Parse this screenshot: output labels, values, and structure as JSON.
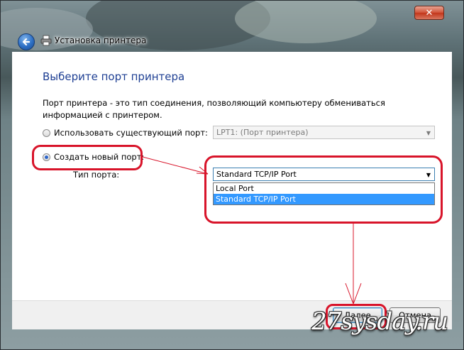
{
  "window": {
    "title": "Установка принтера",
    "close_glyph": "✕"
  },
  "page": {
    "heading": "Выберите порт принтера",
    "description": "Порт принтера - это тип соединения, позволяющий компьютеру обмениваться информацией с принтером."
  },
  "options": {
    "existing_port": {
      "label": "Использовать существующий порт:",
      "selected": false,
      "value": "LPT1: (Порт принтера)"
    },
    "new_port": {
      "label": "Создать новый порт:",
      "selected": true
    },
    "port_type": {
      "label": "Тип порта:",
      "value": "Standard TCP/IP Port",
      "options": [
        "Local Port",
        "Standard TCP/IP Port"
      ],
      "highlighted_option": "Standard TCP/IP Port"
    }
  },
  "footer": {
    "next_label": "Далее",
    "cancel_label": "Отмена"
  },
  "watermark": "27sysday.ru",
  "colors": {
    "heading": "#1e3f93",
    "annotation": "#d8142a",
    "selection": "#3399ff"
  },
  "icons": {
    "back": "back-arrow-icon",
    "printer": "printer-icon",
    "close": "close-icon",
    "dropdown": "chevron-down-icon"
  }
}
